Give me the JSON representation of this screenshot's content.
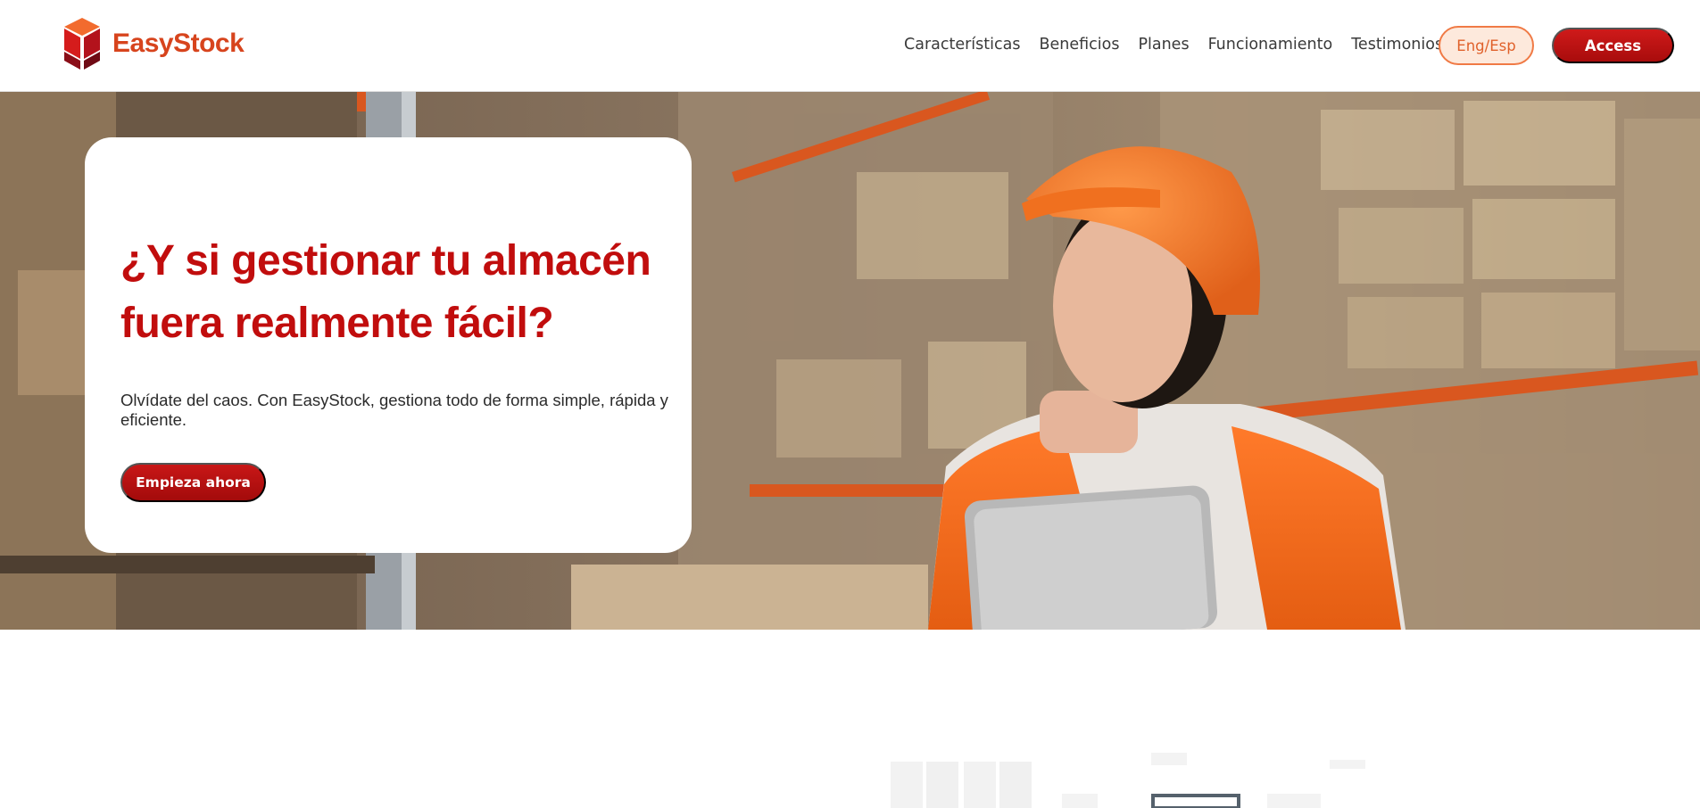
{
  "brand": {
    "name": "EasyStock",
    "logo_icon": "red-box-icon",
    "accent": "#d7441d",
    "primary": "#c10d0d"
  },
  "nav": {
    "items": [
      {
        "label": "Características"
      },
      {
        "label": "Beneficios"
      },
      {
        "label": "Planes"
      },
      {
        "label": "Funcionamiento"
      },
      {
        "label": "Testimonios"
      }
    ],
    "lang_label": "Eng/Esp",
    "access_label": "Access"
  },
  "hero": {
    "title": "¿Y si gestionar tu almacén fuera realmente fácil?",
    "subtitle": "Olvídate del caos. Con EasyStock, gestiona todo de forma simple, rápida y eficiente.",
    "cta_label": "Empieza ahora",
    "image": "warehouse-worker-photo"
  }
}
